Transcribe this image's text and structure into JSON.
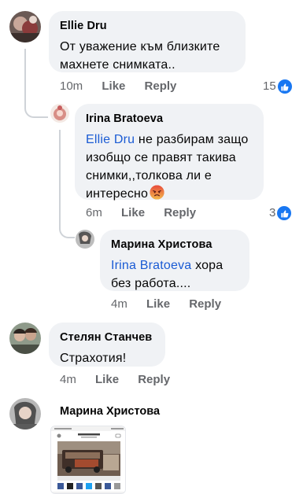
{
  "comments": [
    {
      "author": "Ellie Dru",
      "text": "От уважение към близките махнете снимката..",
      "time": "10m",
      "like_label": "Like",
      "reply_label": "Reply",
      "reaction_count": "15"
    },
    {
      "author": "Irina Bratoeva",
      "mention": "Ellie Dru",
      "text": " не разбирам защо изобщо се правят такива снимки,,толкова ли е интересно",
      "time": "6m",
      "like_label": "Like",
      "reply_label": "Reply",
      "reaction_count": "3"
    },
    {
      "author": "Марина Христова",
      "mention": "Irina Bratoeva",
      "text": " хора без работа....",
      "time": "4m",
      "like_label": "Like",
      "reply_label": "Reply"
    },
    {
      "author": "Стелян Станчев",
      "text": "Страхотия!",
      "time": "4m",
      "like_label": "Like",
      "reply_label": "Reply"
    },
    {
      "author": "Марина Христова"
    }
  ],
  "icons": {
    "reaction": "like-thumb-icon",
    "emoji": "angry-face-emoji-icon"
  },
  "colors": {
    "mention": "#1a5bd4",
    "like_badge": "#1877f2",
    "bubble": "#f0f2f5"
  }
}
